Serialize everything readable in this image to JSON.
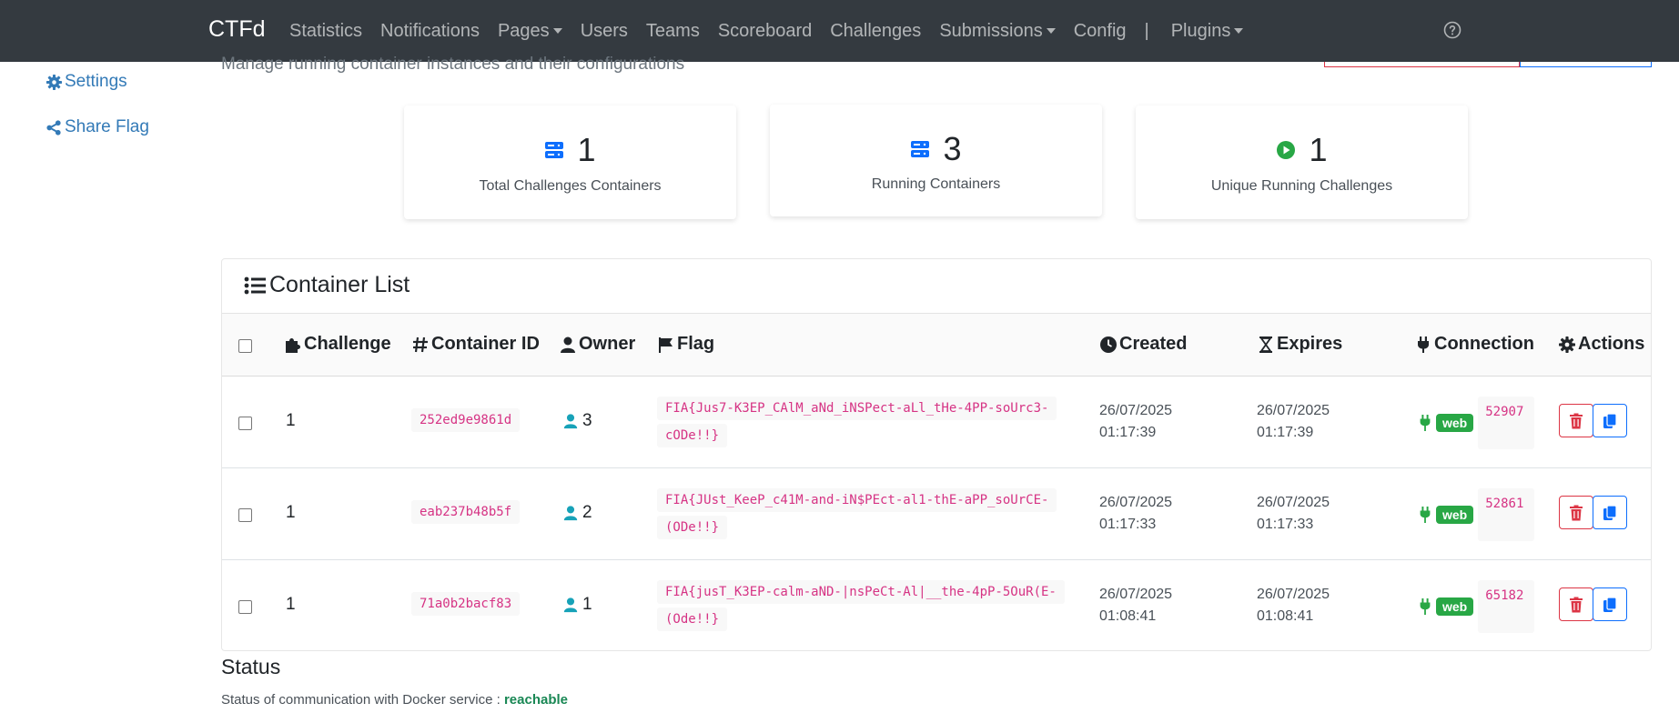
{
  "navbar": {
    "brand": "CTFd",
    "items": [
      {
        "label": "Statistics",
        "dropdown": false
      },
      {
        "label": "Notifications",
        "dropdown": false
      },
      {
        "label": "Pages",
        "dropdown": true
      },
      {
        "label": "Users",
        "dropdown": false
      },
      {
        "label": "Teams",
        "dropdown": false
      },
      {
        "label": "Scoreboard",
        "dropdown": false
      },
      {
        "label": "Challenges",
        "dropdown": false
      },
      {
        "label": "Submissions",
        "dropdown": true
      },
      {
        "label": "Config",
        "dropdown": false
      }
    ],
    "separator": "|",
    "plugins": "Plugins",
    "help_icon": "question-circle-icon"
  },
  "sidebar": {
    "settings": "Settings",
    "share_flag": "Share Flag"
  },
  "header": {
    "subtitle": "Manage running container instances and their configurations"
  },
  "stats": [
    {
      "value": "1",
      "label": "Total Challenges Containers",
      "icon": "server-icon",
      "color": "#0d6efd"
    },
    {
      "value": "3",
      "label": "Running Containers",
      "icon": "server-icon",
      "color": "#0d6efd"
    },
    {
      "value": "1",
      "label": "Unique Running Challenges",
      "icon": "play-circle-icon",
      "color": "#28a745"
    }
  ],
  "container_list": {
    "title": "Container List",
    "columns": {
      "challenge": "Challenge",
      "container_id": "Container ID",
      "owner": "Owner",
      "flag": "Flag",
      "created": "Created",
      "expires": "Expires",
      "connection": "Connection",
      "actions": "Actions"
    },
    "rows": [
      {
        "challenge": "1",
        "container_id": "252ed9e9861d",
        "owner": "3",
        "flag": "FIA{Jus7-K3EP_CAlM_aNd_iNSPect-aLl_tHe-4PP-soUrc3-cODe!!}",
        "created_date": "26/07/2025",
        "created_time": "01:17:39",
        "expires_date": "26/07/2025",
        "expires_time": "01:17:39",
        "badge": "web",
        "port": "52907"
      },
      {
        "challenge": "1",
        "container_id": "eab237b48b5f",
        "owner": "2",
        "flag": "FIA{JUst_KeeP_c41M-and-iN$PEct-al1-thE-aPP_soUrCE-(ODe!!}",
        "created_date": "26/07/2025",
        "created_time": "01:17:33",
        "expires_date": "26/07/2025",
        "expires_time": "01:17:33",
        "badge": "web",
        "port": "52861"
      },
      {
        "challenge": "1",
        "container_id": "71a0b2bacf83",
        "owner": "1",
        "flag": "FIA{jusT_K3EP-calm-aND-|nsPeCt-Al|__the-4pP-5OuR(E-(Ode!!}",
        "created_date": "26/07/2025",
        "created_time": "01:08:41",
        "expires_date": "26/07/2025",
        "expires_time": "01:08:41",
        "badge": "web",
        "port": "65182"
      }
    ]
  },
  "status": {
    "title": "Status",
    "text": "Status of communication with Docker service :",
    "value": "reachable"
  }
}
